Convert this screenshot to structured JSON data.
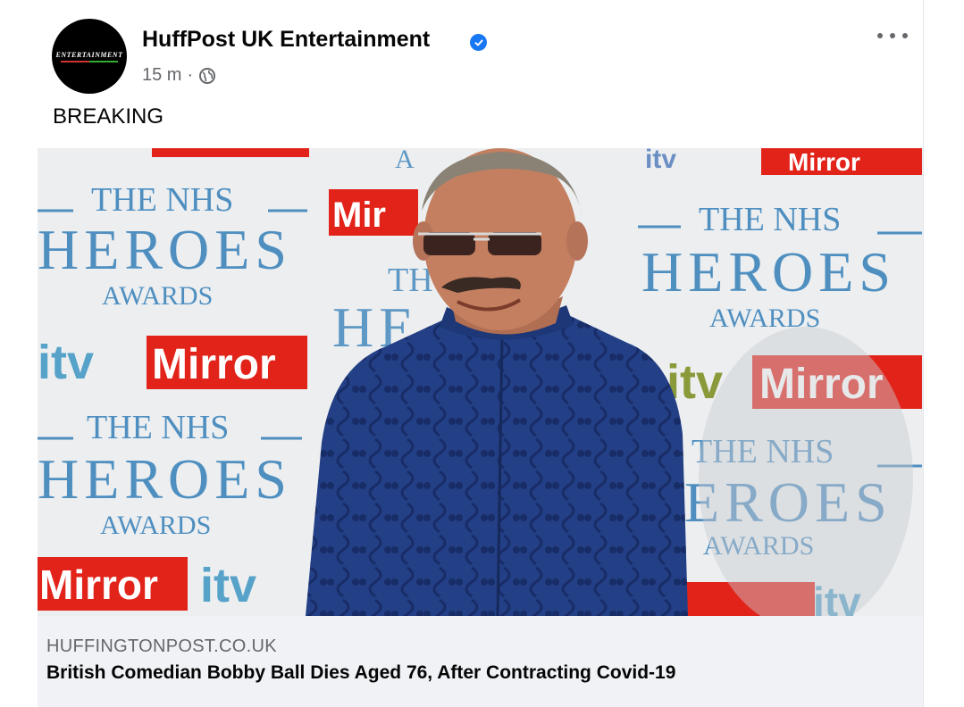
{
  "post": {
    "page_name": "HuffPost UK Entertainment",
    "avatar_text": "ENTERTAINMENT",
    "time": "15 m",
    "separator": "·",
    "text": "BREAKING"
  },
  "photo": {
    "backdrop_lines": {
      "the_nhs": "THE NHS",
      "heroes": "HEROES",
      "awards": "AWARDS",
      "mirror": "Mirror",
      "itv": "itv"
    }
  },
  "link": {
    "domain": "HUFFINGTONPOST.CO.UK",
    "headline": "British Comedian Bobby Ball Dies Aged 76, After Contracting Covid-19"
  },
  "colors": {
    "accent": "#1877f2",
    "secondary_text": "#65676b",
    "footer_bg": "#f0f2f5",
    "mirror_red": "#e2231a",
    "heroes_blue": "#4f8fc0"
  },
  "icons": {
    "verified": "verified-check-icon",
    "globe": "globe-icon",
    "more": "more-options-icon"
  }
}
